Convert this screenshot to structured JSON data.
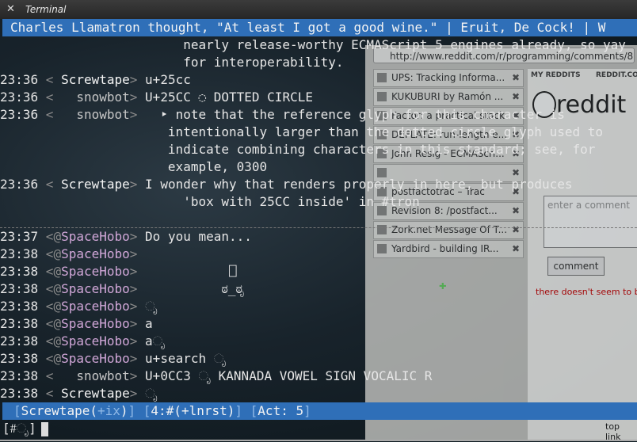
{
  "window": {
    "title": "Terminal",
    "close_glyph": "✕"
  },
  "topic": "Charles Llamatron thought, \"At least I got a good wine.\" | Eruit, De Cock! | W",
  "browser": {
    "url": "http://www.reddit.com/r/programming/comments/8",
    "tabs": [
      "UPS: Tracking Informa...",
      "KUKUBURI by Ramón ...",
      "Factor: a practical stack",
      "DEFLATE: run-length e...",
      "John Resig - ECMAScri...",
      "",
      "postfactotrac – Trac",
      "Revision 8: /postfact...",
      "Zork.net Message Of T...",
      "Yardbird - building IR..."
    ],
    "reddit": {
      "my_reddits": "MY REDDITS",
      "reddit_com": "REDDIT.COM",
      "logo": "reddit",
      "comment_placeholder": "enter a comment",
      "comment_button": "comment",
      "warning": "there doesn't seem to b",
      "top_link": "top link"
    }
  },
  "lines": [
    {
      "time": "",
      "nick": "",
      "msg": "                        nearly release-worthy ECMAScript 5 engines already, so yay",
      "kind": "cont"
    },
    {
      "time": "",
      "nick": "",
      "msg": "                        for interoperability.",
      "kind": "cont"
    },
    {
      "time": "23:36",
      "prefix": " < ",
      "nick": "Screwtape",
      "suffix": "> ",
      "msg": "u+25cc",
      "kind": "w"
    },
    {
      "time": "23:36",
      "prefix": " < ",
      "nick": "snowbot",
      "suffix": "> ",
      "msg": "U+25CC ◌ DOTTED CIRCLE",
      "pad": "  ",
      "kind": "b"
    },
    {
      "time": "23:36",
      "prefix": " < ",
      "nick": "snowbot",
      "suffix": "> ",
      "msg": "  ‣ note that the reference glyph for this character is",
      "pad": "  ",
      "kind": "b"
    },
    {
      "time": "",
      "nick": "",
      "msg": "                      intentionally larger than the dotted circle glyph used to",
      "kind": "cont"
    },
    {
      "time": "",
      "nick": "",
      "msg": "                      indicate combining characters in this standard; see, for",
      "kind": "cont"
    },
    {
      "time": "",
      "nick": "",
      "msg": "                      example, 0300",
      "kind": "cont"
    },
    {
      "time": "23:36",
      "prefix": " < ",
      "nick": "Screwtape",
      "suffix": "> ",
      "msg": "I wonder why that renders properly in here, but produces",
      "kind": "w"
    },
    {
      "time": "",
      "nick": "",
      "msg": "                        'box with 25CC inside' in #tron",
      "kind": "cont"
    },
    {
      "kind": "sep"
    },
    {
      "time": "23:37",
      "prefix": " <@",
      "nick": "SpaceHobo",
      "suffix": "> ",
      "msg": "Do you mean...",
      "kind": "s"
    },
    {
      "time": "23:38",
      "prefix": " <@",
      "nick": "SpaceHobo",
      "suffix": "> ",
      "msg": "",
      "kind": "s"
    },
    {
      "time": "23:38",
      "prefix": " <@",
      "nick": "SpaceHobo",
      "suffix": "> ",
      "msg": "           ⎕",
      "kind": "s"
    },
    {
      "time": "23:38",
      "prefix": " <@",
      "nick": "SpaceHobo",
      "suffix": "> ",
      "msg": "          ಠ_ಠೃ",
      "kind": "s"
    },
    {
      "time": "23:38",
      "prefix": " <@",
      "nick": "SpaceHobo",
      "suffix": "> ",
      "msg": "ೃ",
      "kind": "s"
    },
    {
      "time": "23:38",
      "prefix": " <@",
      "nick": "SpaceHobo",
      "suffix": "> ",
      "msg": "a",
      "kind": "s"
    },
    {
      "time": "23:38",
      "prefix": " <@",
      "nick": "SpaceHobo",
      "suffix": "> ",
      "msg": "aೃ",
      "kind": "s"
    },
    {
      "time": "23:38",
      "prefix": " <@",
      "nick": "SpaceHobo",
      "suffix": "> ",
      "msg": "u+search ೃ",
      "kind": "s"
    },
    {
      "time": "23:38",
      "prefix": " < ",
      "nick": "snowbot",
      "suffix": "> ",
      "msg": "U+0CC3 ೃ KANNADA VOWEL SIGN VOCALIC R",
      "pad": "  ",
      "kind": "b"
    },
    {
      "time": "23:38",
      "prefix": " < ",
      "nick": "Screwtape",
      "suffix": "> ",
      "msg": "ೃ",
      "kind": "w"
    }
  ],
  "statusbar": {
    "nick": "Screwtape(",
    "mode": "+ix",
    "nick_close": ")",
    "window": "4:#",
    "channel_mode": "(+lnrst)",
    "act": "Act: 5"
  },
  "input": {
    "prompt": "[#ೃ]",
    "value": ""
  },
  "colors": {
    "bar_blue": "#2f6fb8",
    "nick_spacehobo": "#d1a7d8",
    "nick_self": "#f5f5f5"
  }
}
